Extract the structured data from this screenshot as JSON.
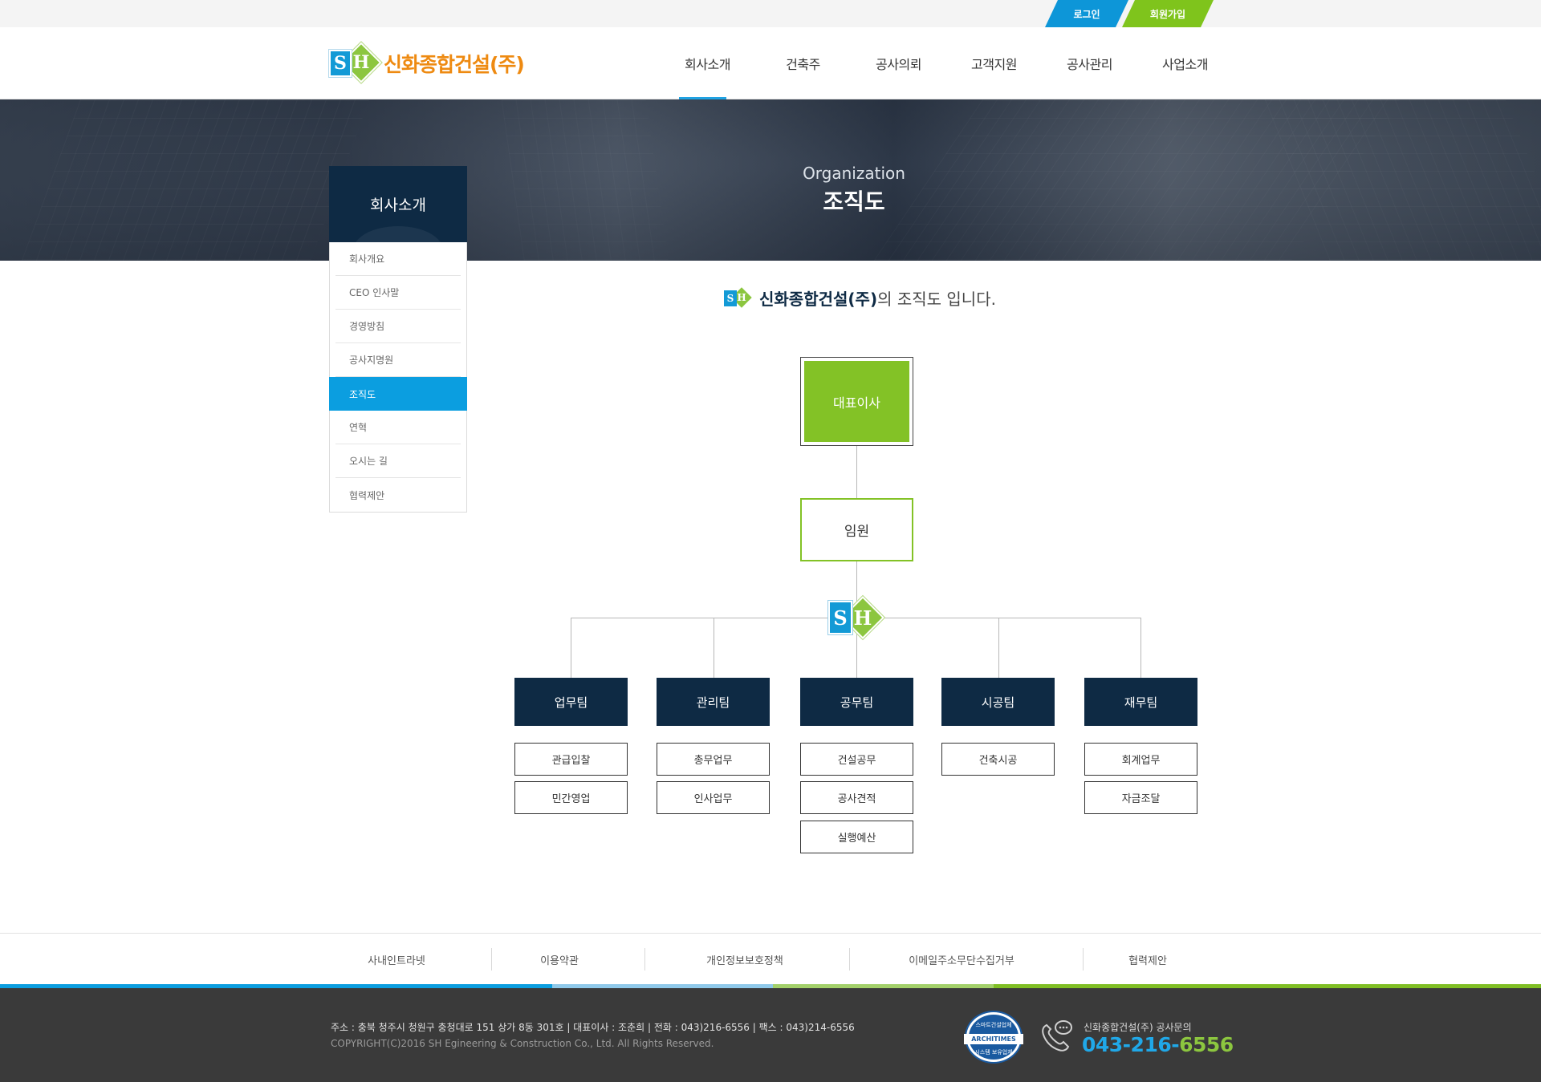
{
  "util": {
    "login": "로그인",
    "join": "회원가입"
  },
  "brand": {
    "mark_s": "S",
    "mark_h": "H",
    "name": "신화종합건설(주)"
  },
  "gnb": [
    "회사소개",
    "건축주",
    "공사의뢰",
    "고객지원",
    "공사관리",
    "사업소개"
  ],
  "visual": {
    "en": "Organization",
    "ko": "조직도"
  },
  "lnb": {
    "title": "회사소개",
    "items": [
      "회사개요",
      "CEO 인사말",
      "경영방침",
      "공사지명원",
      "조직도",
      "연혁",
      "오시는 길",
      "협력제안"
    ],
    "active_index": 4
  },
  "intro": {
    "company": "신화종합건설(주)",
    "rest": "의 조직도 입니다."
  },
  "org": {
    "ceo": "대표이사",
    "exec": "임원",
    "teams": [
      {
        "name": "업무팀",
        "duties": [
          "관급입찰",
          "민간영업"
        ]
      },
      {
        "name": "관리팀",
        "duties": [
          "총무업무",
          "인사업무"
        ]
      },
      {
        "name": "공무팀",
        "duties": [
          "건설공무",
          "공사견적",
          "실행예산"
        ]
      },
      {
        "name": "시공팀",
        "duties": [
          "건축시공"
        ]
      },
      {
        "name": "재무팀",
        "duties": [
          "회계업무",
          "자금조달"
        ]
      }
    ]
  },
  "footer": {
    "links": [
      "사내인트라넷",
      "이용약관",
      "개인정보보호정책",
      "이메일주소무단수집거부",
      "협력제안"
    ],
    "address": "주소 : 충북 청주시 청원구 충청대로 151 상가 8동 301호   |   대표이사 : 조춘희   |   전화 : 043)216-6556   |   팩스 : 043)214-6556",
    "copyright": "COPYRIGHT(C)2016  SH Egineering & Construction  Co., Ltd. All Rights Reserved.",
    "badge": {
      "top": "스마트건설업체",
      "middle": "ARCHITIMES",
      "bottom": "시스템 보유업체"
    },
    "cs_label": "신화종합건설(주) 공사문의",
    "tel_main": "043-216-",
    "tel_tail": "6556"
  },
  "colors": {
    "blue": "#0b9ee0",
    "green": "#83c226",
    "navy": "#0e2a44",
    "orange": "#ee8a11"
  }
}
